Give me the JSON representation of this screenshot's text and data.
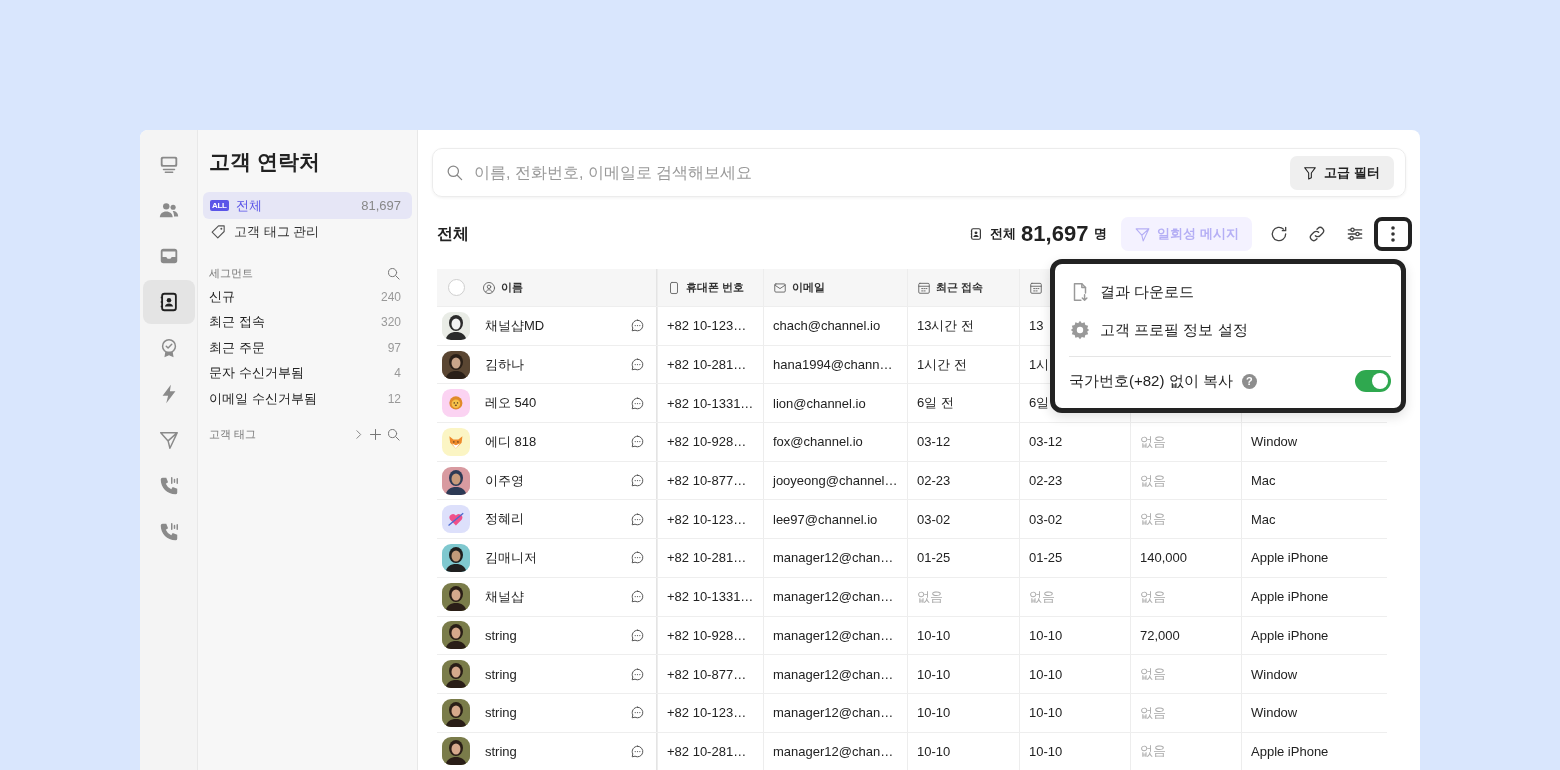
{
  "nav_rail": [
    {
      "selected": false
    },
    {
      "selected": false
    },
    {
      "selected": false
    },
    {
      "selected": true
    },
    {
      "selected": false
    },
    {
      "selected": false
    },
    {
      "selected": false
    },
    {
      "selected": false
    },
    {
      "selected": false
    }
  ],
  "sidebar": {
    "title": "고객 연락처",
    "items": [
      {
        "kind": "all",
        "badge": "ALL",
        "label": "전체",
        "count": "81,697",
        "selected": true
      },
      {
        "kind": "tag",
        "label": "고객 태그 관리",
        "selected": false
      }
    ],
    "segment_header": "세그먼트",
    "segments": [
      {
        "label": "신규",
        "count": "240"
      },
      {
        "label": "최근 접속",
        "count": "320"
      },
      {
        "label": "최근 주문",
        "count": "97"
      },
      {
        "label": "문자 수신거부됨",
        "count": "4"
      },
      {
        "label": "이메일 수신거부됨",
        "count": "12"
      }
    ],
    "tag_header": "고객 태그"
  },
  "search": {
    "placeholder": "이름, 전화번호, 이메일로 검색해보세요",
    "filter_button": "고급 필터"
  },
  "toolbar": {
    "title": "전체",
    "total_label": "전체",
    "total_count": "81,697",
    "total_unit": "명",
    "message_button": {
      "label": "일회성 메시지",
      "disabled": true
    },
    "more_active": true
  },
  "menu": {
    "items": [
      {
        "kind": "download",
        "label": "결과 다운로드"
      },
      {
        "kind": "settings",
        "label": "고객 프로필 정보 설정"
      }
    ],
    "toggle": {
      "label": "국가번호(+82) 없이 복사",
      "help": "?",
      "on": true
    }
  },
  "table": {
    "select_all": {
      "checked": false
    },
    "columns": [
      "이름",
      "휴대폰 번호",
      "이메일",
      "최근 접속"
    ],
    "rows": [
      {
        "cells": [
          {
            "text": "채널샵MD",
            "muted": false
          },
          {
            "text": "+82 10-123…",
            "muted": false
          },
          {
            "text": "chach@channel.io",
            "muted": false
          },
          {
            "text": "13시간 전",
            "muted": false
          },
          {
            "text": "13",
            "muted": false
          }
        ]
      },
      {
        "cells": [
          {
            "text": "김하나",
            "muted": false
          },
          {
            "text": "+82 10-281…",
            "muted": false
          },
          {
            "text": "hana1994@chann…",
            "muted": false
          },
          {
            "text": "1시간 전",
            "muted": false
          },
          {
            "text": "1시",
            "muted": false
          }
        ]
      },
      {
        "avatar": {
          "kind": "lion",
          "color": "#fbd3f2"
        },
        "cells": [
          {
            "text": "레오 540",
            "muted": false
          },
          {
            "text": "+82 10-1331…",
            "muted": false
          },
          {
            "text": "lion@channel.io",
            "muted": false
          },
          {
            "text": "6일 전",
            "muted": false
          },
          {
            "text": "6일",
            "muted": false
          }
        ]
      },
      {
        "avatar": {
          "kind": "fox",
          "color": "#fbf5c4"
        },
        "cells": [
          {
            "text": "에디 818",
            "muted": false
          },
          {
            "text": "+82 10-928…",
            "muted": false
          },
          {
            "text": "fox@channel.io",
            "muted": false
          },
          {
            "text": "03-12",
            "muted": false
          },
          {
            "text": "03-12",
            "muted": false
          },
          {
            "text": "없음",
            "muted": true
          },
          {
            "text": "Window",
            "muted": false
          }
        ]
      },
      {
        "cells": [
          {
            "text": "이주영",
            "muted": false
          },
          {
            "text": "+82 10-877…",
            "muted": false
          },
          {
            "text": "jooyeong@channel…",
            "muted": false
          },
          {
            "text": "02-23",
            "muted": false
          },
          {
            "text": "02-23",
            "muted": false
          },
          {
            "text": "없음",
            "muted": true
          },
          {
            "text": "Mac",
            "muted": false
          }
        ]
      },
      {
        "avatar": {
          "kind": "heart",
          "color": "#dde0fb"
        },
        "cells": [
          {
            "text": "정혜리",
            "muted": false
          },
          {
            "text": "+82 10-123…",
            "muted": false
          },
          {
            "text": "lee97@channel.io",
            "muted": false
          },
          {
            "text": "03-02",
            "muted": false
          },
          {
            "text": "03-02",
            "muted": false
          },
          {
            "text": "없음",
            "muted": true
          },
          {
            "text": "Mac",
            "muted": false
          }
        ]
      },
      {
        "cells": [
          {
            "text": "김매니저",
            "muted": false
          },
          {
            "text": "+82 10-281…",
            "muted": false
          },
          {
            "text": "manager12@chan…",
            "muted": false
          },
          {
            "text": "01-25",
            "muted": false
          },
          {
            "text": "01-25",
            "muted": false
          },
          {
            "text": "140,000",
            "muted": false
          },
          {
            "text": "Apple iPhone",
            "muted": false
          }
        ]
      },
      {
        "cells": [
          {
            "text": "채널샵",
            "muted": false
          },
          {
            "text": "+82 10-1331…",
            "muted": false
          },
          {
            "text": "manager12@chan…",
            "muted": false
          },
          {
            "text": "없음",
            "muted": true
          },
          {
            "text": "없음",
            "muted": true
          },
          {
            "text": "없음",
            "muted": true
          },
          {
            "text": "Apple iPhone",
            "muted": false
          }
        ]
      },
      {
        "cells": [
          {
            "text": "string",
            "muted": false
          },
          {
            "text": "+82 10-928…",
            "muted": false
          },
          {
            "text": "manager12@chan…",
            "muted": false
          },
          {
            "text": "10-10",
            "muted": false
          },
          {
            "text": "10-10",
            "muted": false
          },
          {
            "text": "72,000",
            "muted": false
          },
          {
            "text": "Apple iPhone",
            "muted": false
          }
        ]
      },
      {
        "cells": [
          {
            "text": "string",
            "muted": false
          },
          {
            "text": "+82 10-877…",
            "muted": false
          },
          {
            "text": "manager12@chan…",
            "muted": false
          },
          {
            "text": "10-10",
            "muted": false
          },
          {
            "text": "10-10",
            "muted": false
          },
          {
            "text": "없음",
            "muted": true
          },
          {
            "text": "Window",
            "muted": false
          }
        ]
      },
      {
        "cells": [
          {
            "text": "string",
            "muted": false
          },
          {
            "text": "+82 10-123…",
            "muted": false
          },
          {
            "text": "manager12@chan…",
            "muted": false
          },
          {
            "text": "10-10",
            "muted": false
          },
          {
            "text": "10-10",
            "muted": false
          },
          {
            "text": "없음",
            "muted": true
          },
          {
            "text": "Window",
            "muted": false
          }
        ]
      },
      {
        "cells": [
          {
            "text": "string",
            "muted": false
          },
          {
            "text": "+82 10-281…",
            "muted": false
          },
          {
            "text": "manager12@chan…",
            "muted": false
          },
          {
            "text": "10-10",
            "muted": false
          },
          {
            "text": "10-10",
            "muted": false
          },
          {
            "text": "없음",
            "muted": true
          },
          {
            "text": "Apple iPhone",
            "muted": false
          }
        ]
      }
    ]
  }
}
